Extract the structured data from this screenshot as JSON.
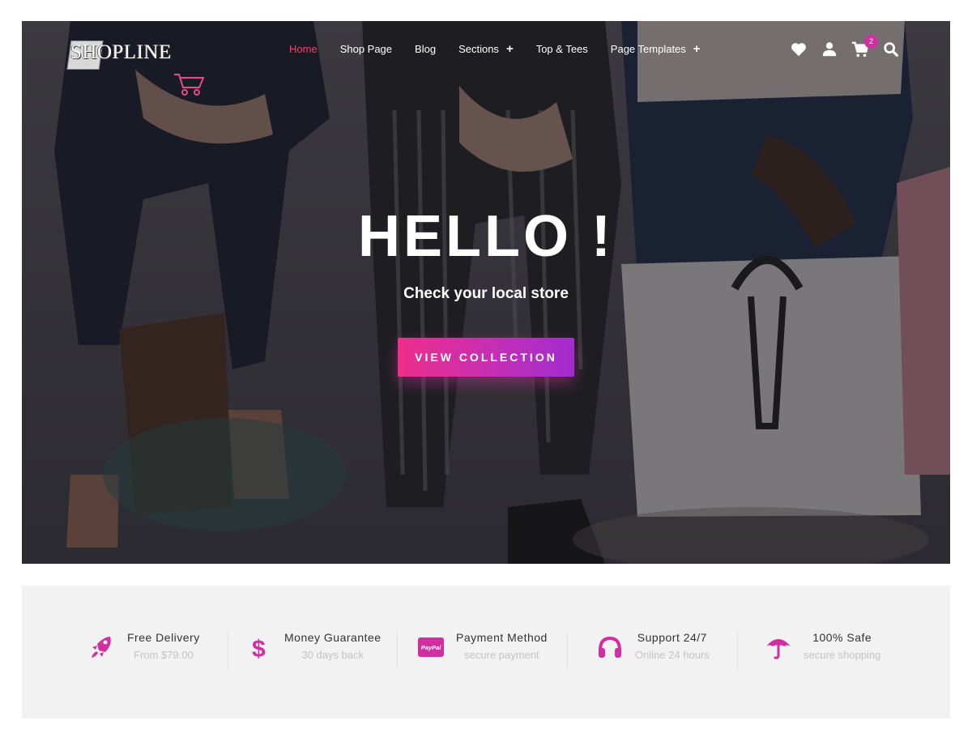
{
  "brand": {
    "logo_text": "SHOPLINE"
  },
  "nav": {
    "items": [
      {
        "label": "Home",
        "active": true,
        "has_submenu": false
      },
      {
        "label": "Shop Page",
        "active": false,
        "has_submenu": false
      },
      {
        "label": "Blog",
        "active": false,
        "has_submenu": false
      },
      {
        "label": "Sections",
        "active": false,
        "has_submenu": true
      },
      {
        "label": "Top & Tees",
        "active": false,
        "has_submenu": false
      },
      {
        "label": "Page Templates",
        "active": false,
        "has_submenu": true
      }
    ],
    "submenu_symbol": "+",
    "icons": [
      "heart-icon",
      "user-icon",
      "cart-icon",
      "search-icon"
    ],
    "cart_count": "2"
  },
  "hero": {
    "title": "HELLO !",
    "subtitle": "Check your local store",
    "cta_label": "VIEW COLLECTION"
  },
  "features": [
    {
      "icon": "rocket-icon",
      "title": "Free Delivery",
      "subtitle": "From $79.00"
    },
    {
      "icon": "dollar-icon",
      "title": "Money Guarantee",
      "subtitle": "30 days back"
    },
    {
      "icon": "paypal-icon",
      "icon_text": "PayPal",
      "title": "Payment Method",
      "subtitle": "secure payment"
    },
    {
      "icon": "headphones-icon",
      "title": "Support 24/7",
      "subtitle": "Online 24 hours"
    },
    {
      "icon": "umbrella-icon",
      "title": "100% Safe",
      "subtitle": "secure shopping"
    }
  ],
  "colors": {
    "accent": "#d02fa2",
    "active_nav": "#e94560",
    "gradient_start": "#ee2e8b",
    "gradient_end": "#a22ccf",
    "feature_bg": "#f2f2f2"
  }
}
